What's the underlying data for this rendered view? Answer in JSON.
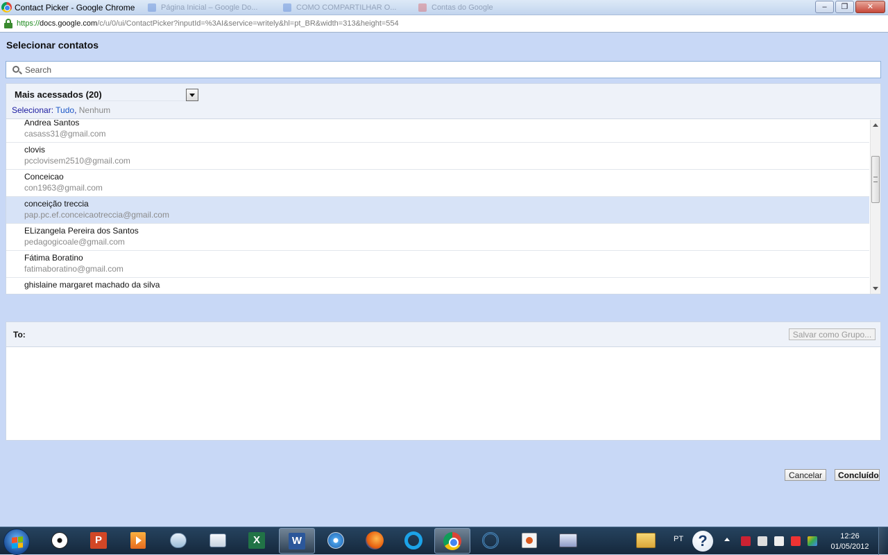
{
  "browser": {
    "window_title": "Contact Picker - Google Chrome",
    "background_tabs": [
      {
        "label": "Página Inicial – Google Do..."
      },
      {
        "label": "COMO COMPARTILHAR O..."
      },
      {
        "label": "Contas do Google"
      }
    ],
    "controls": {
      "minimize": "‒",
      "maximize": "❐",
      "close": "✕"
    },
    "url": {
      "scheme": "https://",
      "host": "docs.google.com",
      "path": "/c/u/0/ui/ContactPicker?inputId=%3AI&service=writely&hl=pt_BR&width=313&height=554"
    }
  },
  "picker": {
    "title": "Selecionar contatos",
    "search_placeholder": "Search",
    "group_select": {
      "selected": "Mais acessados (20)"
    },
    "select_row": {
      "label": "Selecionar:",
      "all": "Tudo",
      "separator": ",",
      "none": "Nenhum"
    },
    "contacts": [
      {
        "name": "Andrea Santos",
        "email": "casass31@gmail.com",
        "selected": false
      },
      {
        "name": "clovis",
        "email": "pcclovisem2510@gmail.com",
        "selected": false
      },
      {
        "name": "Conceicao",
        "email": "con1963@gmail.com",
        "selected": false
      },
      {
        "name": "conceição treccia",
        "email": "pap.pc.ef.conceicaotreccia@gmail.com",
        "selected": true
      },
      {
        "name": "ELizangela Pereira dos Santos",
        "email": "pedagogicoale@gmail.com",
        "selected": false
      },
      {
        "name": "Fátima Boratino",
        "email": "fatimaboratino@gmail.com",
        "selected": false
      },
      {
        "name": "ghislaine margaret machado da silva",
        "email": "",
        "selected": false
      }
    ],
    "to": {
      "label": "To:",
      "save_group_button": "Salvar como Grupo..."
    },
    "buttons": {
      "cancel": "Cancelar",
      "done": "Concluído"
    }
  },
  "taskbar": {
    "apps": [
      {
        "icon": "soccer-icon"
      },
      {
        "icon": "powerpoint-icon",
        "glyph": "P"
      },
      {
        "icon": "media-player-icon"
      },
      {
        "icon": "itunes-icon"
      },
      {
        "icon": "check-app-icon"
      },
      {
        "icon": "excel-icon",
        "glyph": "X"
      },
      {
        "icon": "word-icon",
        "glyph": "W"
      },
      {
        "icon": "safari-icon"
      },
      {
        "icon": "firefox-icon"
      },
      {
        "icon": "ie-icon",
        "glyph": "e"
      },
      {
        "icon": "chrome-icon"
      },
      {
        "icon": "cortana-icon"
      },
      {
        "icon": "camera-app-icon"
      },
      {
        "icon": "mail-icon"
      },
      {
        "icon": "folder-icon"
      }
    ],
    "language": "PT",
    "help_glyph": "?",
    "clock": {
      "time": "12:26",
      "date": "01/05/2012"
    }
  },
  "colors": {
    "page_background": "#c8d8f6",
    "selected_row": "#d7e3f7",
    "link_blue": "#1a56c8"
  }
}
